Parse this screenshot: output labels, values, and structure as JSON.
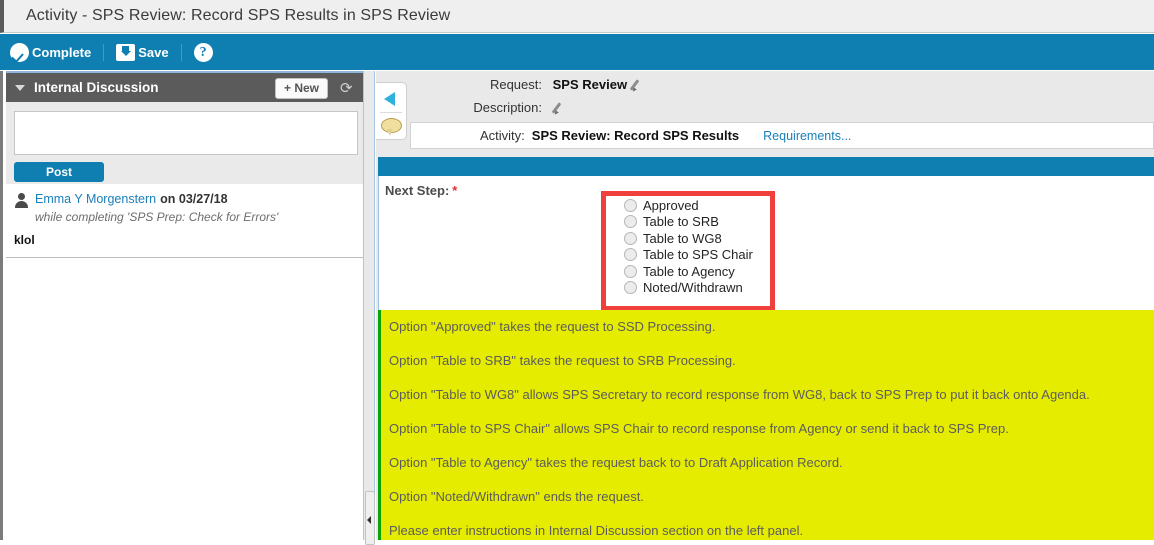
{
  "window": {
    "title": "Activity - SPS Review: Record SPS Results in SPS Review"
  },
  "toolbar": {
    "complete_label": "Complete",
    "save_label": "Save",
    "help_label": "?",
    "icons": [
      "check-circle-icon",
      "save-icon",
      "help-icon"
    ],
    "background_color": "#0f7fb2"
  },
  "discussion": {
    "header_title": "Internal Discussion",
    "new_button_label": "+ New",
    "refresh_icon": "refresh-icon",
    "collapse_icon": "caret-down-icon",
    "composer": {
      "value": "",
      "placeholder": ""
    },
    "post_button_label": "Post",
    "posts": [
      {
        "author": "Emma Y Morgenstern",
        "on": "on 03/27/18",
        "context": "while completing 'SPS Prep: Check for Errors'",
        "body": "klol",
        "avatar_icon": "user-avatar-icon"
      }
    ]
  },
  "sidetab": {
    "collapse_icon": "collapse-left-icon",
    "comments_icon": "comment-bubble-icon"
  },
  "details": {
    "request_label": "Request:",
    "request_value": "SPS Review",
    "request_edit_icon": "pencil-icon",
    "description_label": "Description:",
    "description_value": "",
    "description_edit_icon": "pencil-icon",
    "activity_label": "Activity:",
    "activity_value": "SPS Review: Record SPS Results",
    "requirements_link": "Requirements..."
  },
  "form": {
    "next_step_label": "Next Step:",
    "required_marker": "*",
    "highlight_color": "#f0403c",
    "options": [
      {
        "label": "Approved",
        "selected": false
      },
      {
        "label": "Table to SRB",
        "selected": false
      },
      {
        "label": "Table to WG8",
        "selected": false
      },
      {
        "label": "Table to SPS Chair",
        "selected": false
      },
      {
        "label": "Table to Agency",
        "selected": false
      },
      {
        "label": "Noted/Withdrawn",
        "selected": false
      }
    ]
  },
  "instructions": {
    "background_color": "#e6ec00",
    "accent_color": "#0aa30a",
    "lines": [
      "Option \"Approved\" takes the request to SSD Processing.",
      "Option \"Table to SRB\" takes the request to SRB Processing.",
      "Option \"Table to WG8\" allows SPS Secretary to record response from WG8, back to SPS Prep to put it back onto Agenda.",
      "Option \"Table to SPS Chair\" allows SPS Chair to record response from Agency or send it back to SPS Prep.",
      "Option \"Table to Agency\" takes the request back to to Draft Application Record.",
      "Option \"Noted/Withdrawn\" ends the request.",
      "Please enter instructions in Internal Discussion section on the left panel."
    ]
  }
}
